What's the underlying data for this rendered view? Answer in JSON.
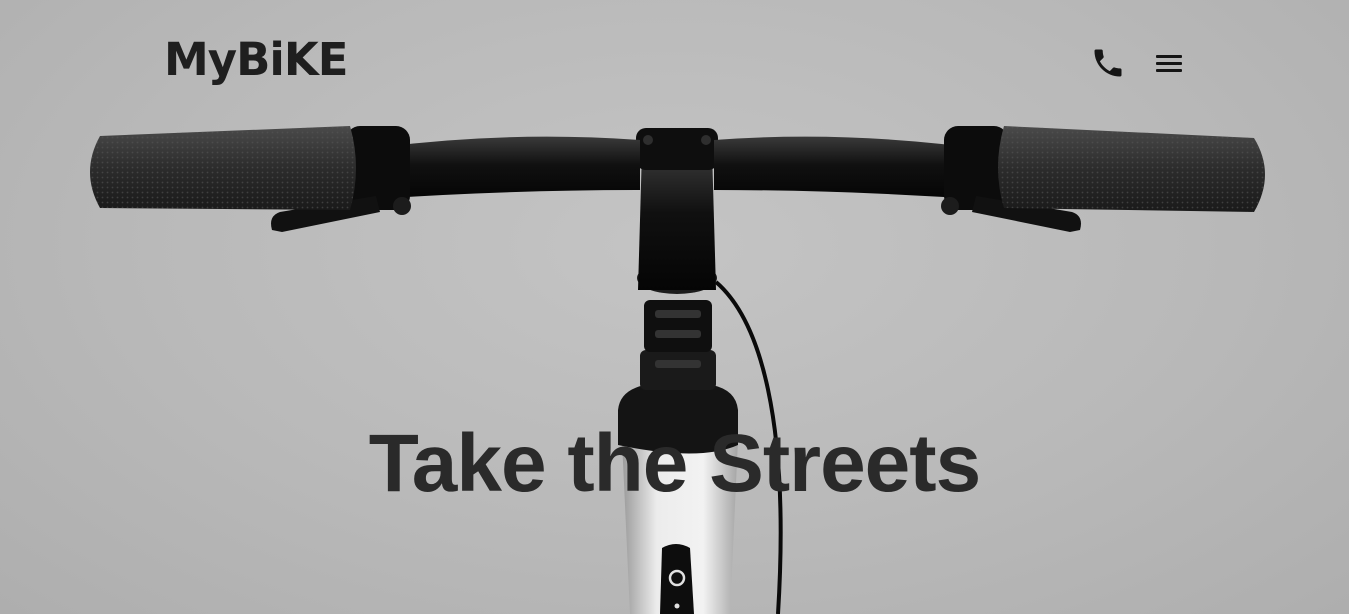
{
  "brand": {
    "logo_text": "MyBiKE"
  },
  "header": {
    "phone_icon": "phone-icon",
    "menu_icon": "hamburger-menu-icon"
  },
  "hero": {
    "title": "Take the Streets",
    "image": "bicycle-handlebar-front-view"
  },
  "colors": {
    "background": "#bdbdbd",
    "text": "#2a2a2a",
    "bike": "#111111",
    "frame": "#e6e6e6"
  }
}
